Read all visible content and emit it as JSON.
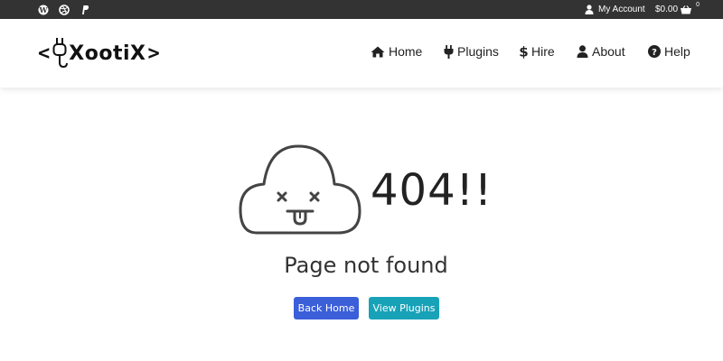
{
  "topbar": {
    "social_icons": [
      "wordpress-icon",
      "dribbble-icon",
      "paypal-icon"
    ],
    "account_label": "My Account",
    "cart_amount": "$0.00",
    "cart_count": "0"
  },
  "header": {
    "logo_text": "XootiX",
    "nav": [
      {
        "label": "Home",
        "icon": "home-icon"
      },
      {
        "label": "Plugins",
        "icon": "plug-icon"
      },
      {
        "label": "Hire",
        "icon": "dollar-icon"
      },
      {
        "label": "About",
        "icon": "user-icon"
      },
      {
        "label": "Help",
        "icon": "question-circle-icon"
      }
    ]
  },
  "error": {
    "code": "404!!",
    "message": "Page not found",
    "illustration": "sad-cloud-icon"
  },
  "actions": {
    "back_home": "Back Home",
    "view_plugins": "View Plugins"
  },
  "colors": {
    "topbar_bg": "#333333",
    "primary_button": "#3b5fd9",
    "info_button": "#17a2b8"
  }
}
